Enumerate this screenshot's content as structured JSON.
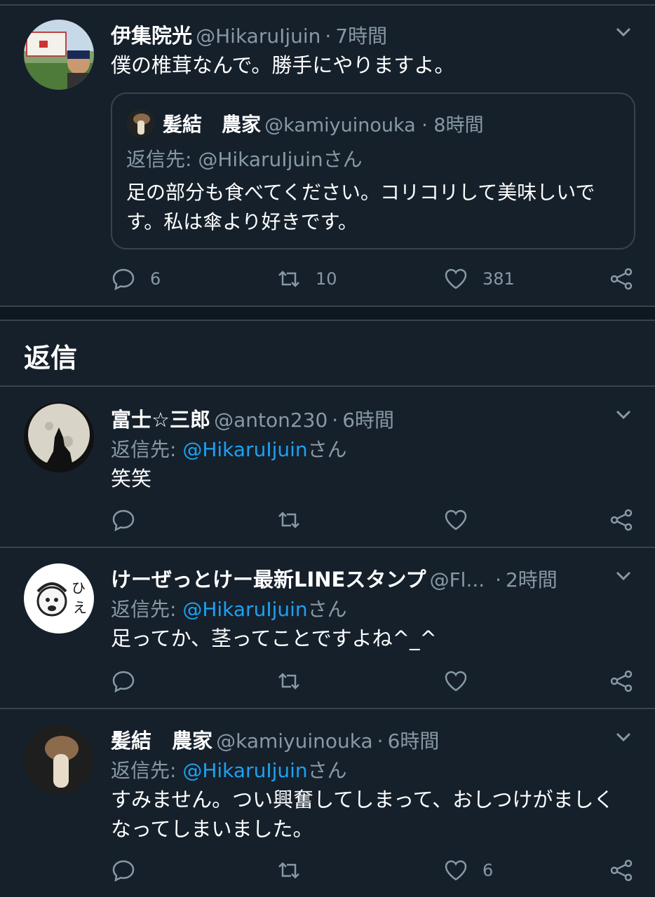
{
  "main_tweet": {
    "name": "伊集院光",
    "handle": "@HikaruIjuin",
    "time": "7時間",
    "text": "僕の椎茸なんで。勝手にやりますよ。",
    "quote": {
      "name": "髪結　農家",
      "handle": "@kamiyuinouka · 8時間",
      "reply_label": "返信先: @HikaruIjuinさん",
      "text": "足の部分も食べてください。コリコリして美味しいです。私は傘より好きです。"
    },
    "counts": {
      "reply": "6",
      "retweet": "10",
      "like": "381"
    }
  },
  "section_title": "返信",
  "replies": [
    {
      "name": "富士☆三郎",
      "handle": "@anton230",
      "time": "6時間",
      "reply_prefix": "返信先: ",
      "reply_mention": "@HikaruIjuin",
      "reply_suffix": "さん",
      "text": "笑笑",
      "like_count": ""
    },
    {
      "name": "けーぜっとけー最新LINEスタンプ",
      "handle": "@Fl...",
      "time": "2時間",
      "reply_prefix": "返信先: ",
      "reply_mention": "@HikaruIjuin",
      "reply_suffix": "さん",
      "text": "足ってか、茎ってことですよね^_^",
      "like_count": ""
    },
    {
      "name": "髪結　農家",
      "handle": "@kamiyuinouka",
      "time": "6時間",
      "reply_prefix": "返信先: ",
      "reply_mention": "@HikaruIjuin",
      "reply_suffix": "さん",
      "text": "すみません。つい興奮してしまって、おしつけがましくなってしまいました。",
      "like_count": "6"
    }
  ],
  "icons": {
    "reply": "reply-icon",
    "retweet": "retweet-icon",
    "like": "heart-icon",
    "share": "share-icon",
    "menu": "chevron-down-icon"
  },
  "colors": {
    "background": "#15202b",
    "border": "#38444d",
    "secondary_text": "#8899a6",
    "link": "#1da1f2"
  }
}
